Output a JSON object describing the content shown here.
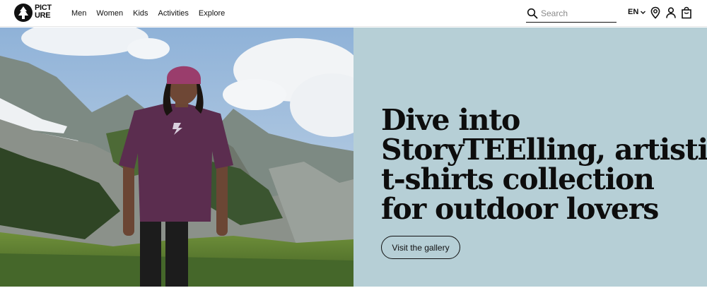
{
  "brand": {
    "logo_lines": [
      "PICT",
      "URE"
    ],
    "logo_icon": "tree-circle-icon"
  },
  "nav": {
    "items": [
      {
        "label": "Men"
      },
      {
        "label": "Women"
      },
      {
        "label": "Kids"
      },
      {
        "label": "Activities"
      },
      {
        "label": "Explore"
      }
    ]
  },
  "search": {
    "placeholder": "Search",
    "value": "",
    "icon": "search-icon"
  },
  "header_actions": {
    "language": "EN",
    "language_icon": "chevron-down-icon",
    "store_icon": "location-pin-icon",
    "account_icon": "user-icon",
    "cart_icon": "shopping-bag-icon"
  },
  "hero": {
    "image_description_icon": "hero-photo",
    "headline_lines": [
      "Dive into",
      "StoryTEElling, artistic",
      "t-shirts collection",
      "for outdoor lovers"
    ],
    "cta_label": "Visit the gallery",
    "panel_color": "#b6cfd6",
    "shirt_color": "#5b2d4f",
    "beanie_color": "#9a3d6c"
  }
}
